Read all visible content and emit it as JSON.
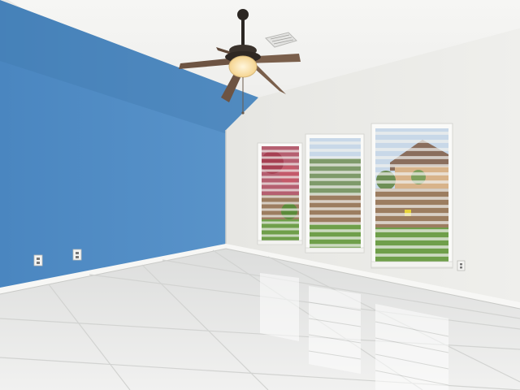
{
  "scene": {
    "kind": "empty room photograph",
    "colors": {
      "accent_wall": "#4f8cc4",
      "accent_wall_shadow": "#3f77ad",
      "white_wall": "#eeeeea",
      "ceiling": "#f4f4f2",
      "floor_tile": "#e6e7e6",
      "grout": "#d4d5d3",
      "baseboard": "#f7f7f5",
      "fan_wood": "#7a5f4b",
      "fan_metal": "#2b2622",
      "fan_glow": "#ffe7b5",
      "blind_slat": "#f1f1ee",
      "lawn": "#6f9f4a",
      "foliage": "#b24a5a",
      "sky": "#c8d8e8",
      "house_roof": "#8a6e5d",
      "fence": "#9c7d60"
    },
    "fixtures": {
      "ceiling_fan": {
        "blades": 5,
        "light": "on"
      },
      "vent": "ceiling vent",
      "windows": 3,
      "wall_outlets": 3
    }
  }
}
